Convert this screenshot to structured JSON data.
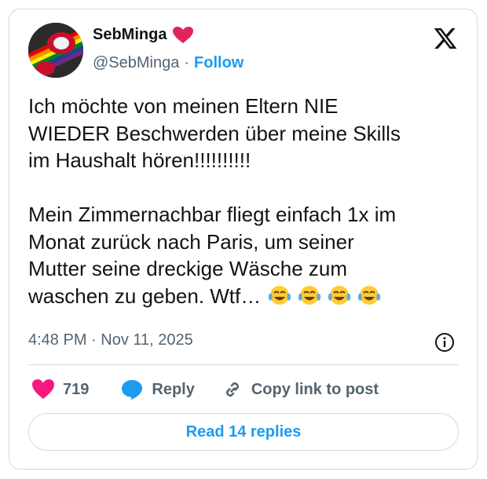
{
  "author": {
    "name": "SebMinga",
    "handle": "@SebMinga",
    "follow_label": "Follow",
    "badge_icon": "red-heart-icon"
  },
  "tweet": {
    "lines_p1": [
      "Ich möchte von meinen Eltern NIE",
      "WIEDER Beschwerden über meine Skills",
      "im Haushalt hören!!!!!!!!!!"
    ],
    "lines_p2": [
      "Mein Zimmernachbar fliegt einfach 1x im",
      "Monat zurück nach Paris, um seiner",
      "Mutter seine dreckige Wäsche zum"
    ],
    "last_line": "waschen zu geben. Wtf…",
    "emojis": [
      "tears-of-joy-icon",
      "tears-of-joy-icon",
      "tears-of-joy-icon",
      "tears-of-joy-icon"
    ],
    "timestamp": "4:48 PM · Nov 11, 2025"
  },
  "actions": {
    "like_count": "719",
    "reply_label": "Reply",
    "copy_label": "Copy link to post"
  },
  "read_replies_label": "Read 14 replies",
  "colors": {
    "accent": "#1d9bf0",
    "heart": "#f91880",
    "muted": "#536471",
    "border": "#cfd9de"
  }
}
